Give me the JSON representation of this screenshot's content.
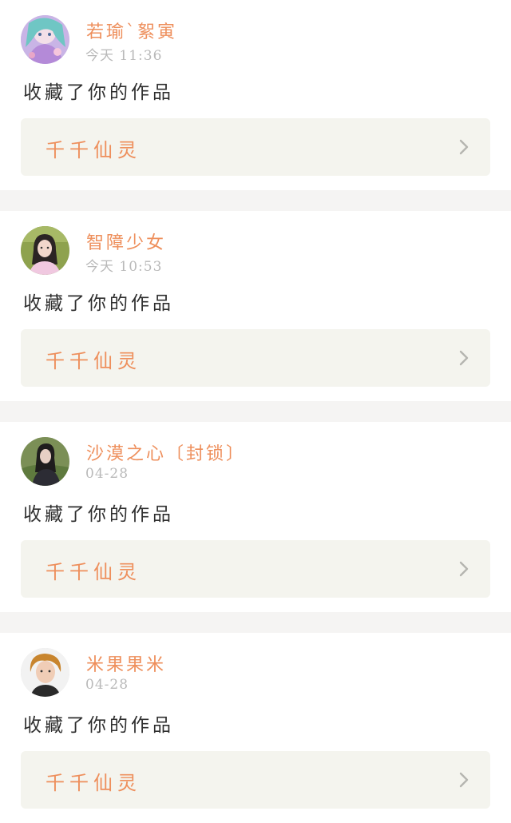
{
  "feed": [
    {
      "username": "若瑜`絮寅",
      "time": "今天 11:36",
      "action": "收藏了你的作品",
      "work_title": "千千仙灵",
      "avatar_icon": "anime-girl-avatar"
    },
    {
      "username": "智障少女",
      "time": "今天 10:53",
      "action": "收藏了你的作品",
      "work_title": "千千仙灵",
      "avatar_icon": "girl-photo-avatar"
    },
    {
      "username": "沙漠之心〔封锁〕",
      "time": "04-28",
      "action": "收藏了你的作品",
      "work_title": "千千仙灵",
      "avatar_icon": "girl-in-grass-avatar"
    },
    {
      "username": "米果果米",
      "time": "04-28",
      "action": "收藏了你的作品",
      "work_title": "千千仙灵",
      "avatar_icon": "boy-photo-avatar"
    }
  ],
  "colors": {
    "accent": "#ee8f5c",
    "text": "#2f2f2f",
    "muted": "#b9b9b9",
    "work_bg": "#f4f4ee",
    "separator": "#f5f4f3"
  }
}
